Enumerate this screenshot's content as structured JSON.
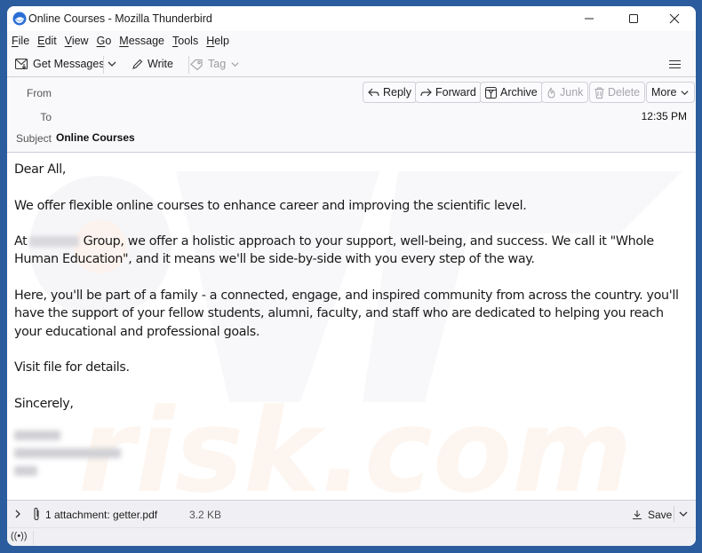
{
  "window": {
    "title": "Online Courses - Mozilla Thunderbird",
    "controls": {
      "minimize": "minimize-icon",
      "maximize": "maximize-icon",
      "close": "close-icon"
    }
  },
  "menubar": {
    "items": [
      {
        "label": "File",
        "mnemonic": "F",
        "rest": "ile"
      },
      {
        "label": "Edit",
        "mnemonic": "E",
        "rest": "dit"
      },
      {
        "label": "View",
        "mnemonic": "V",
        "rest": "iew"
      },
      {
        "label": "Go",
        "mnemonic": "G",
        "rest": "o"
      },
      {
        "label": "Message",
        "mnemonic": "M",
        "rest": "essage"
      },
      {
        "label": "Tools",
        "mnemonic": "T",
        "rest": "ools"
      },
      {
        "label": "Help",
        "mnemonic": "H",
        "rest": "elp"
      }
    ]
  },
  "toolbar": {
    "get_messages": "Get Messages",
    "write": "Write",
    "tag": "Tag"
  },
  "header": {
    "from_label": "From",
    "to_label": "To",
    "subject_label": "Subject",
    "subject": "Online Courses",
    "time": "12:35 PM",
    "buttons": {
      "reply": "Reply",
      "forward": "Forward",
      "archive": "Archive",
      "junk": "Junk",
      "delete": "Delete",
      "more": "More"
    }
  },
  "body": {
    "greeting": "Dear All,",
    "p1": "We offer flexible online courses to enhance career and improving the scientific level.",
    "p2_prefix": "At",
    "p2_rest": " Group, we offer a holistic approach to your support, well-being, and success. We call it \"Whole Human Education\", and it means we'll be side-by-side with you every step of the way.",
    "p3": "Here, you'll be part of a family - a connected, engage, and inspired community from across the country. you'll have the support of your fellow students, alumni, faculty, and staff who are dedicated to helping you reach your educational and professional goals.",
    "p4": "Visit file for details.",
    "closing": "Sincerely,"
  },
  "attachment": {
    "summary": "1 attachment: getter.pdf",
    "size": "3.2 KB",
    "save_label": "Save"
  },
  "statusbar": {
    "icon": "((•))"
  }
}
